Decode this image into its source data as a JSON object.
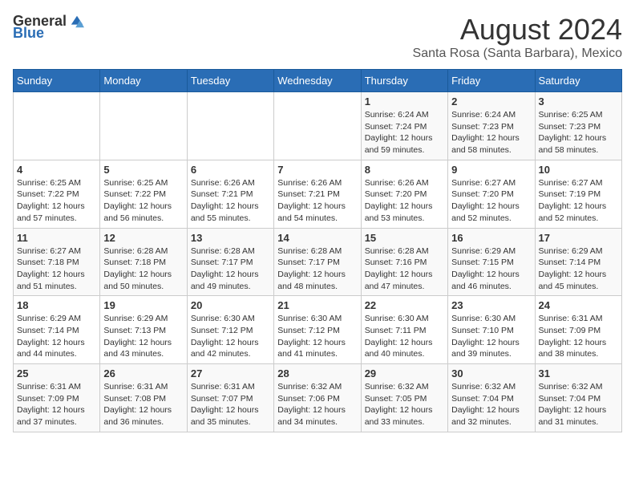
{
  "logo": {
    "general": "General",
    "blue": "Blue"
  },
  "title": "August 2024",
  "subtitle": "Santa Rosa (Santa Barbara), Mexico",
  "days_header": [
    "Sunday",
    "Monday",
    "Tuesday",
    "Wednesday",
    "Thursday",
    "Friday",
    "Saturday"
  ],
  "weeks": [
    [
      {
        "day": "",
        "info": ""
      },
      {
        "day": "",
        "info": ""
      },
      {
        "day": "",
        "info": ""
      },
      {
        "day": "",
        "info": ""
      },
      {
        "day": "1",
        "info": "Sunrise: 6:24 AM\nSunset: 7:24 PM\nDaylight: 12 hours and 59 minutes."
      },
      {
        "day": "2",
        "info": "Sunrise: 6:24 AM\nSunset: 7:23 PM\nDaylight: 12 hours and 58 minutes."
      },
      {
        "day": "3",
        "info": "Sunrise: 6:25 AM\nSunset: 7:23 PM\nDaylight: 12 hours and 58 minutes."
      }
    ],
    [
      {
        "day": "4",
        "info": "Sunrise: 6:25 AM\nSunset: 7:22 PM\nDaylight: 12 hours and 57 minutes."
      },
      {
        "day": "5",
        "info": "Sunrise: 6:25 AM\nSunset: 7:22 PM\nDaylight: 12 hours and 56 minutes."
      },
      {
        "day": "6",
        "info": "Sunrise: 6:26 AM\nSunset: 7:21 PM\nDaylight: 12 hours and 55 minutes."
      },
      {
        "day": "7",
        "info": "Sunrise: 6:26 AM\nSunset: 7:21 PM\nDaylight: 12 hours and 54 minutes."
      },
      {
        "day": "8",
        "info": "Sunrise: 6:26 AM\nSunset: 7:20 PM\nDaylight: 12 hours and 53 minutes."
      },
      {
        "day": "9",
        "info": "Sunrise: 6:27 AM\nSunset: 7:20 PM\nDaylight: 12 hours and 52 minutes."
      },
      {
        "day": "10",
        "info": "Sunrise: 6:27 AM\nSunset: 7:19 PM\nDaylight: 12 hours and 52 minutes."
      }
    ],
    [
      {
        "day": "11",
        "info": "Sunrise: 6:27 AM\nSunset: 7:18 PM\nDaylight: 12 hours and 51 minutes."
      },
      {
        "day": "12",
        "info": "Sunrise: 6:28 AM\nSunset: 7:18 PM\nDaylight: 12 hours and 50 minutes."
      },
      {
        "day": "13",
        "info": "Sunrise: 6:28 AM\nSunset: 7:17 PM\nDaylight: 12 hours and 49 minutes."
      },
      {
        "day": "14",
        "info": "Sunrise: 6:28 AM\nSunset: 7:17 PM\nDaylight: 12 hours and 48 minutes."
      },
      {
        "day": "15",
        "info": "Sunrise: 6:28 AM\nSunset: 7:16 PM\nDaylight: 12 hours and 47 minutes."
      },
      {
        "day": "16",
        "info": "Sunrise: 6:29 AM\nSunset: 7:15 PM\nDaylight: 12 hours and 46 minutes."
      },
      {
        "day": "17",
        "info": "Sunrise: 6:29 AM\nSunset: 7:14 PM\nDaylight: 12 hours and 45 minutes."
      }
    ],
    [
      {
        "day": "18",
        "info": "Sunrise: 6:29 AM\nSunset: 7:14 PM\nDaylight: 12 hours and 44 minutes."
      },
      {
        "day": "19",
        "info": "Sunrise: 6:29 AM\nSunset: 7:13 PM\nDaylight: 12 hours and 43 minutes."
      },
      {
        "day": "20",
        "info": "Sunrise: 6:30 AM\nSunset: 7:12 PM\nDaylight: 12 hours and 42 minutes."
      },
      {
        "day": "21",
        "info": "Sunrise: 6:30 AM\nSunset: 7:12 PM\nDaylight: 12 hours and 41 minutes."
      },
      {
        "day": "22",
        "info": "Sunrise: 6:30 AM\nSunset: 7:11 PM\nDaylight: 12 hours and 40 minutes."
      },
      {
        "day": "23",
        "info": "Sunrise: 6:30 AM\nSunset: 7:10 PM\nDaylight: 12 hours and 39 minutes."
      },
      {
        "day": "24",
        "info": "Sunrise: 6:31 AM\nSunset: 7:09 PM\nDaylight: 12 hours and 38 minutes."
      }
    ],
    [
      {
        "day": "25",
        "info": "Sunrise: 6:31 AM\nSunset: 7:09 PM\nDaylight: 12 hours and 37 minutes."
      },
      {
        "day": "26",
        "info": "Sunrise: 6:31 AM\nSunset: 7:08 PM\nDaylight: 12 hours and 36 minutes."
      },
      {
        "day": "27",
        "info": "Sunrise: 6:31 AM\nSunset: 7:07 PM\nDaylight: 12 hours and 35 minutes."
      },
      {
        "day": "28",
        "info": "Sunrise: 6:32 AM\nSunset: 7:06 PM\nDaylight: 12 hours and 34 minutes."
      },
      {
        "day": "29",
        "info": "Sunrise: 6:32 AM\nSunset: 7:05 PM\nDaylight: 12 hours and 33 minutes."
      },
      {
        "day": "30",
        "info": "Sunrise: 6:32 AM\nSunset: 7:04 PM\nDaylight: 12 hours and 32 minutes."
      },
      {
        "day": "31",
        "info": "Sunrise: 6:32 AM\nSunset: 7:04 PM\nDaylight: 12 hours and 31 minutes."
      }
    ]
  ]
}
